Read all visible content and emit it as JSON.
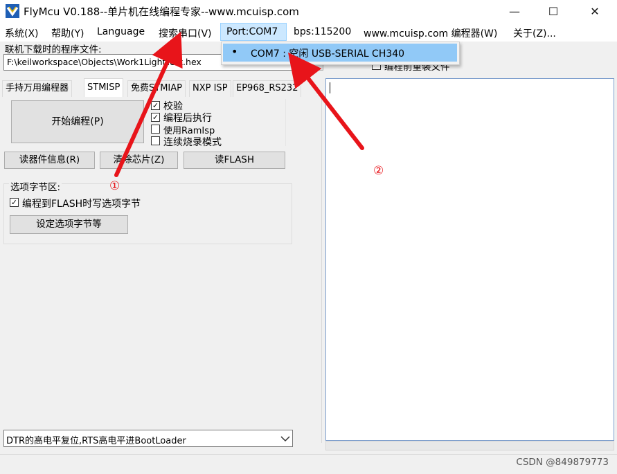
{
  "window": {
    "title": "FlyMcu V0.188--单片机在线编程专家--www.mcuisp.com",
    "minimize": "—",
    "maximize": "☐",
    "close": "✕"
  },
  "menu": [
    "系统(X)",
    "帮助(Y)",
    "Language",
    "搜索串口(V)",
    "Port:COM7",
    "bps:115200",
    "www.mcuisp.com 编程器(W)",
    "关于(Z)..."
  ],
  "port_dropdown": {
    "items": [
      {
        "bullet": "•",
        "label": "COM7 : 空闲 USB-SERIAL CH340"
      }
    ]
  },
  "file": {
    "label": "联机下载时的程序文件:",
    "path": "F:\\keilworkspace\\Objects\\Work1LightTest.hex",
    "browse": "...",
    "reload_label": "编程前重装文件"
  },
  "tabs": [
    "手持万用编程器",
    "STMISP",
    "免费STMIAP",
    "NXP ISP",
    "EP968_RS232"
  ],
  "buttons": {
    "start": "开始编程(P)",
    "read_info": "读器件信息(R)",
    "erase": "清除芯片(Z)",
    "read_flash": "读FLASH",
    "set_option": "设定选项字节等"
  },
  "checkboxes": [
    {
      "label": "校验",
      "checked": true
    },
    {
      "label": "编程后执行",
      "checked": true
    },
    {
      "label": "使用RamIsp",
      "checked": false
    },
    {
      "label": "连续烧录模式",
      "checked": false
    }
  ],
  "option_group": {
    "title": "选项字节区:",
    "checkbox": {
      "label": "编程到FLASH时写选项字节",
      "checked": true
    }
  },
  "bottom_select": {
    "value": "DTR的高电平复位,RTS高电平进BootLoader"
  },
  "annotations": [
    "①",
    "②"
  ],
  "watermark": "CSDN @849879773",
  "colors": {
    "arrow": "#e8141a",
    "highlight": "#cce8ff",
    "selected": "#91c9f7",
    "log_border": "#7a9ccc"
  }
}
